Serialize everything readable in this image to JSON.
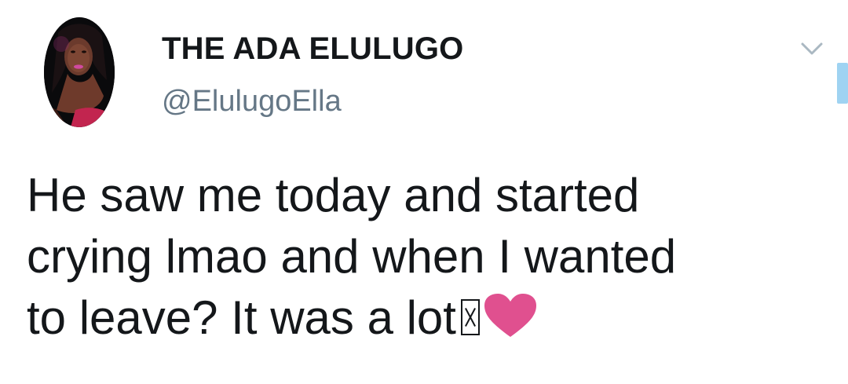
{
  "tweet": {
    "display_name": "THE ADA ELULUGO",
    "handle": "@ElulugoElla",
    "text_lines": [
      "He saw me today and started",
      "crying lmao and when I wanted",
      "to leave? It was a lot"
    ],
    "emojis": [
      "missing-glyph-icon",
      "pink-heart-icon"
    ],
    "colors": {
      "text": "#14171a",
      "handle": "#657786",
      "heart": "#e0508f",
      "accent": "#9fd3f2"
    }
  }
}
